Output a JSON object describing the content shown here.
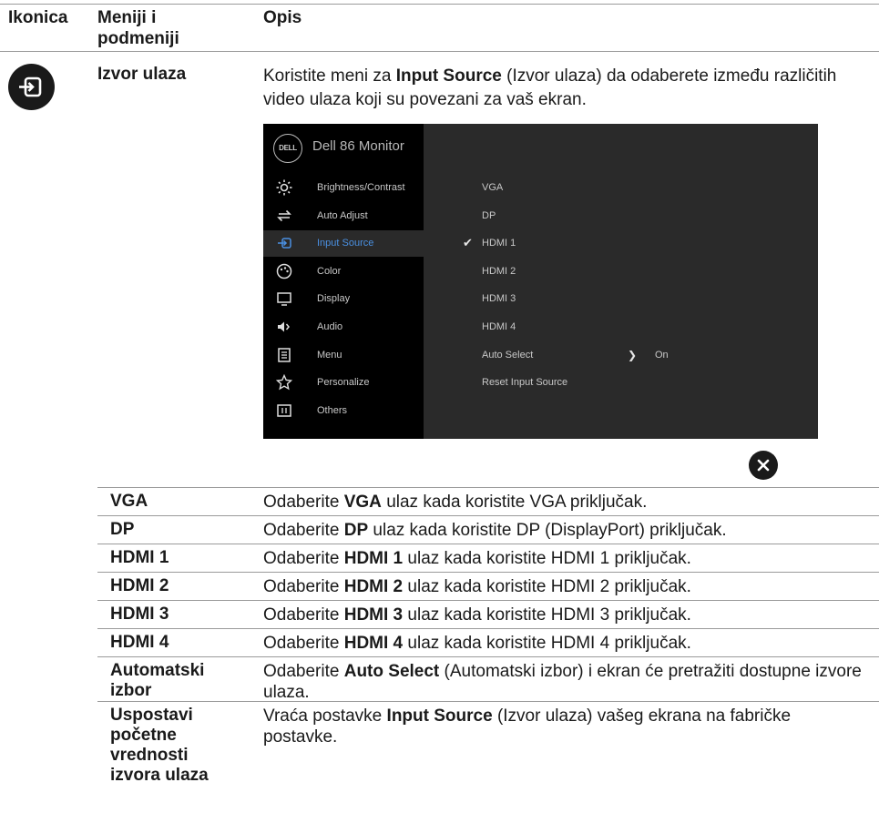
{
  "header": {
    "col_icon": "Ikonica",
    "col_menu_line1": "Meniji i",
    "col_menu_line2": "podmeniji",
    "col_desc": "Opis"
  },
  "section": {
    "icon": "input-source-icon",
    "name": "Izvor ulaza",
    "intro_pre": "Koristite meni za ",
    "intro_bold": "Input Source",
    "intro_post": " (Izvor ulaza) da odaberete između različitih video ulaza koji su povezani za vaš ekran."
  },
  "osd": {
    "logo": "DELL",
    "title": "Dell 86 Monitor",
    "menu": [
      {
        "label": "Brightness/Contrast",
        "icon": "brightness-icon"
      },
      {
        "label": "Auto Adjust",
        "icon": "auto-adjust-icon"
      },
      {
        "label": "Input Source",
        "icon": "input-source-icon",
        "active": true
      },
      {
        "label": "Color",
        "icon": "color-icon"
      },
      {
        "label": "Display",
        "icon": "display-icon"
      },
      {
        "label": "Audio",
        "icon": "audio-icon"
      },
      {
        "label": "Menu",
        "icon": "menu-icon"
      },
      {
        "label": "Personalize",
        "icon": "star-icon"
      },
      {
        "label": "Others",
        "icon": "others-icon"
      }
    ],
    "options": [
      "VGA",
      "DP",
      "HDMI 1",
      "HDMI 2",
      "HDMI 3",
      "HDMI 4",
      "Auto Select",
      "Reset Input Source"
    ],
    "selected": "HDMI 1",
    "auto_select_value": "On",
    "active_color": "#4a90e2"
  },
  "rows": [
    {
      "key": [
        "VGA"
      ],
      "pre": "Odaberite ",
      "bold": "VGA",
      "post": " ulaz kada koristite VGA priključak."
    },
    {
      "key": [
        "DP"
      ],
      "pre": "Odaberite ",
      "bold": "DP",
      "post": " ulaz kada koristite DP (DisplayPort) priključak."
    },
    {
      "key": [
        "HDMI 1"
      ],
      "pre": "Odaberite ",
      "bold": "HDMI 1",
      "post": " ulaz kada koristite HDMI 1 priključak."
    },
    {
      "key": [
        "HDMI 2"
      ],
      "pre": "Odaberite ",
      "bold": "HDMI 2",
      "post": " ulaz kada koristite HDMI 2 priključak."
    },
    {
      "key": [
        "HDMI 3"
      ],
      "pre": "Odaberite ",
      "bold": "HDMI 3",
      "post": " ulaz kada koristite HDMI 3 priključak."
    },
    {
      "key": [
        "HDMI 4"
      ],
      "pre": "Odaberite ",
      "bold": "HDMI 4",
      "post": " ulaz kada koristite HDMI 4 priključak."
    },
    {
      "key": [
        "Automatski",
        "izbor"
      ],
      "pre": "Odaberite ",
      "bold": "Auto Select",
      "post": " (Automatski izbor) i ekran će pretražiti dostupne izvore ulaza."
    },
    {
      "key": [
        "Uspostavi",
        "početne",
        "vrednosti",
        "izvora ulaza"
      ],
      "pre": "Vraća postavke ",
      "bold": "Input Source",
      "post": " (Izvor ulaza) vašeg ekrana na fabričke postavke."
    }
  ]
}
